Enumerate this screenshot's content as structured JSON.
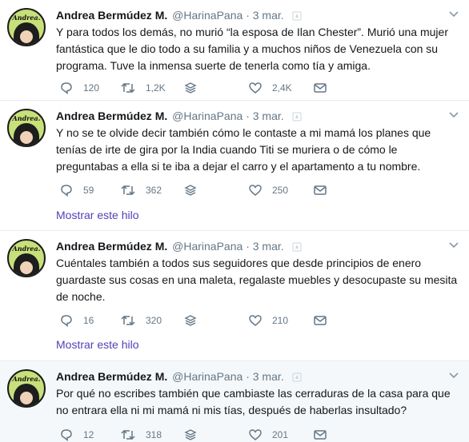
{
  "tweets": [
    {
      "name": "Andrea Bermúdez M.",
      "handle": "@HarinaPana",
      "date": "3 mar.",
      "avatar_text": "Andrea.",
      "text": "Y para todos los demás, no murió “la esposa de Ilan Chester”. Murió una mujer fantástica que le dio todo a su familia y a muchos niños de Venezuela con su programa. Tuve la inmensa suerte de tenerla como tía y amiga.",
      "replies": "120",
      "retweets": "1,2K",
      "likes": "2,4K"
    },
    {
      "name": "Andrea Bermúdez M.",
      "handle": "@HarinaPana",
      "date": "3 mar.",
      "avatar_text": "Andrea.",
      "text": "Y no se te olvide decir también cómo le contaste a mi mamá los planes que tenías de irte de gira por la India cuando Titi se muriera o de cómo le preguntabas a ella si te iba a dejar el carro y el apartamento a tu nombre.",
      "replies": "59",
      "retweets": "362",
      "likes": "250",
      "thread_link": "Mostrar este hilo"
    },
    {
      "name": "Andrea Bermúdez M.",
      "handle": "@HarinaPana",
      "date": "3 mar.",
      "avatar_text": "Andrea.",
      "text": "Cuéntales también a todos sus seguidores que desde principios de enero guardaste sus cosas en una maleta, regalaste muebles y desocupaste su mesita de noche.",
      "replies": "16",
      "retweets": "320",
      "likes": "210",
      "thread_link": "Mostrar este hilo"
    },
    {
      "name": "Andrea Bermúdez M.",
      "handle": "@HarinaPana",
      "date": "3 mar.",
      "avatar_text": "Andrea.",
      "text": "Por qué no escribes también que cambiaste las cerraduras de la casa para que no entrara ella ni mi mamá ni mis tías, después de haberlas insultado?",
      "replies": "12",
      "retweets": "318",
      "likes": "201"
    }
  ],
  "separator": "·",
  "colors": {
    "text": "#14171a",
    "secondary": "#657786",
    "link": "#553eb8",
    "divider": "#e6ecf0",
    "highlight_bg": "#f5f8fa"
  },
  "icons": [
    "avatar",
    "notification-bell-icon",
    "chevron-down-icon",
    "reply-icon",
    "retweet-icon",
    "stack-icon",
    "heart-icon",
    "envelope-icon"
  ]
}
